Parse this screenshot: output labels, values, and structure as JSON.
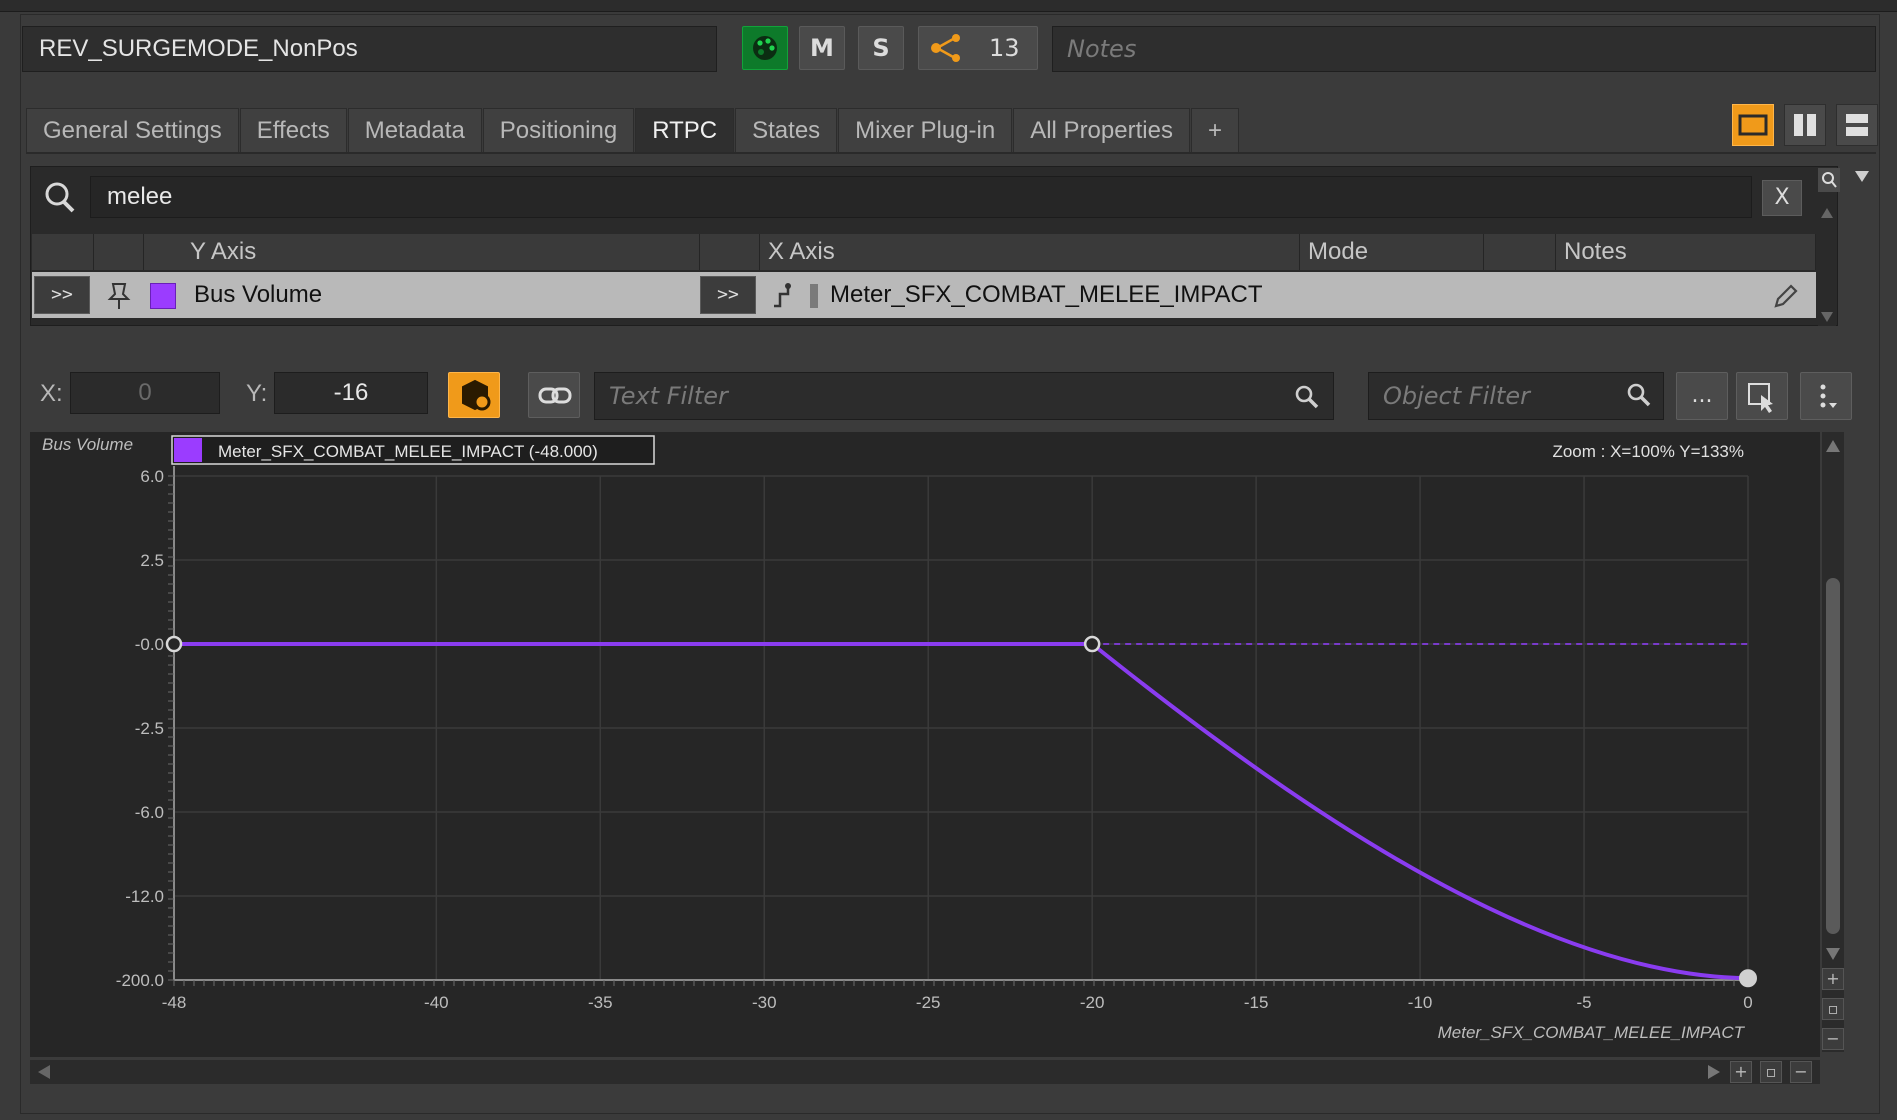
{
  "header": {
    "object_name": "REV_SURGEMODE_NonPos",
    "mute_label": "M",
    "solo_label": "S",
    "reference_count": "13",
    "notes_placeholder": "Notes"
  },
  "tabs": [
    {
      "label": "General Settings"
    },
    {
      "label": "Effects"
    },
    {
      "label": "Metadata"
    },
    {
      "label": "Positioning"
    },
    {
      "label": "RTPC",
      "active": true
    },
    {
      "label": "States"
    },
    {
      "label": "Mixer Plug-in"
    },
    {
      "label": "All Properties"
    },
    {
      "label": "+"
    }
  ],
  "rtpc_list": {
    "search_value": "melee",
    "clear_label": "X",
    "columns": {
      "y_axis": "Y Axis",
      "x_axis": "X Axis",
      "mode": "Mode",
      "notes": "Notes"
    },
    "row": {
      "expand_label": ">>",
      "y_axis": "Bus Volume",
      "x_axis": "Meter_SFX_COMBAT_MELEE_IMPACT",
      "swatch_color": "#9b3cff"
    }
  },
  "graph_toolbar": {
    "x_label": "X:",
    "x_value": "0",
    "y_label": "Y:",
    "y_value": "-16",
    "text_filter_placeholder": "Text Filter",
    "object_filter_placeholder": "Object Filter",
    "more_label": "..."
  },
  "chart_data": {
    "type": "line",
    "ylabel": "Bus Volume",
    "xlabel": "Meter_SFX_COMBAT_MELEE_IMPACT",
    "legend": "Meter_SFX_COMBAT_MELEE_IMPACT (-48.000)",
    "zoom_text": "Zoom : X=100% Y=133%",
    "xlim": [
      -48,
      0
    ],
    "x_ticks": [
      -48,
      -40,
      -35,
      -30,
      -25,
      -20,
      -15,
      -10,
      -5,
      0
    ],
    "x_tick_labels": [
      "-48",
      "-40",
      "-35",
      "-30",
      "-25",
      "-20",
      "-15",
      "-10",
      "-5",
      "0"
    ],
    "y_tick_labels": [
      "6.0",
      "2.5",
      "-0.0",
      "-2.5",
      "-6.0",
      "-12.0",
      "-200.0"
    ],
    "series": [
      {
        "name": "Meter_SFX_COMBAT_MELEE_IMPACT",
        "color": "#8a3cf0",
        "points": [
          [
            -48,
            0
          ],
          [
            -20,
            0
          ],
          [
            0,
            -16
          ]
        ]
      }
    ],
    "grid": true
  }
}
